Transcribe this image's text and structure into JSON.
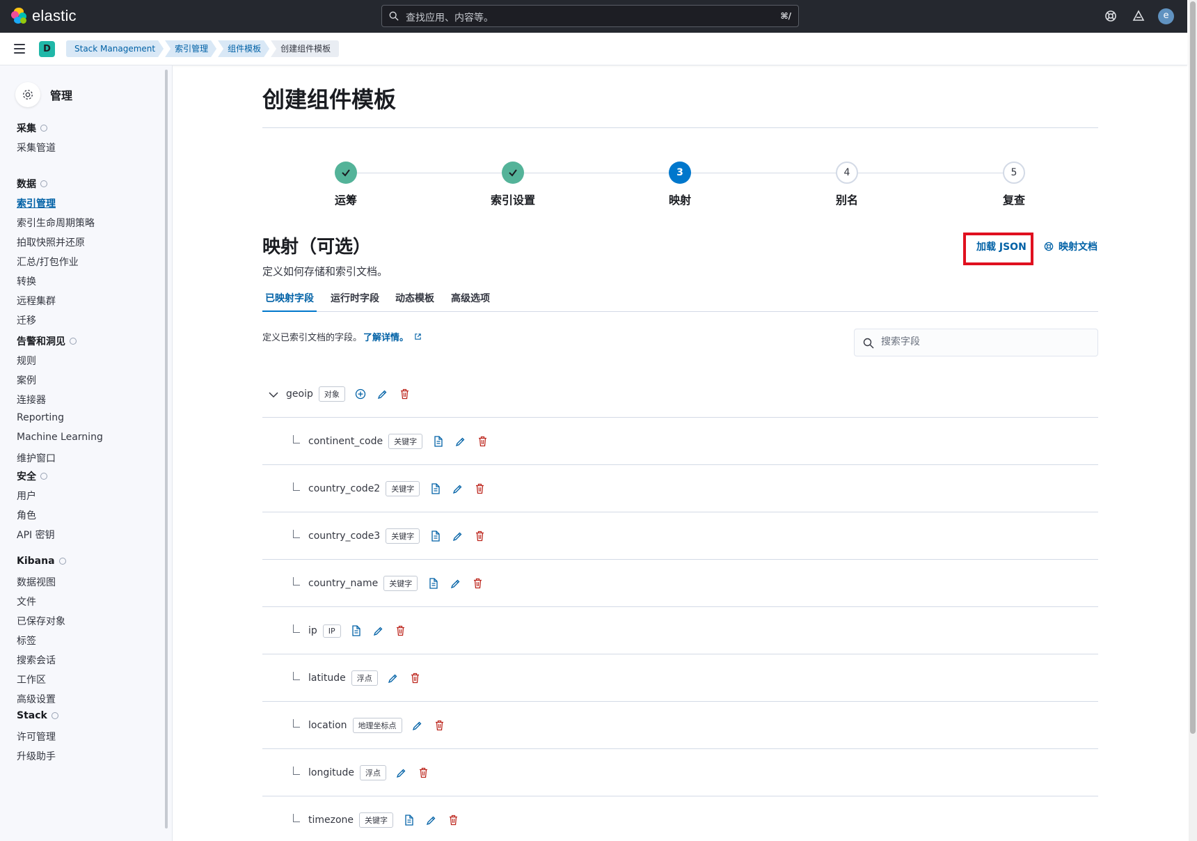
{
  "header": {
    "logo_text": "elastic",
    "search_placeholder": "查找应用、内容等。",
    "search_shortcut": "⌘/",
    "user_initial": "e"
  },
  "subheader": {
    "space_initial": "D",
    "breadcrumbs": [
      "Stack Management",
      "索引管理",
      "组件模板",
      "创建组件模板"
    ]
  },
  "sidebar": {
    "title": "管理",
    "sections": [
      {
        "heading": "采集",
        "items": [
          "采集管道"
        ]
      },
      {
        "heading": "数据",
        "items": [
          "索引管理",
          "索引生命周期策略",
          "拍取快照并还原",
          "汇总/打包作业",
          "转换",
          "远程集群",
          "迁移"
        ]
      },
      {
        "heading": "告警和洞见",
        "items": [
          "规则",
          "案例",
          "连接器",
          "Reporting",
          "Machine Learning",
          "维护窗口"
        ]
      },
      {
        "heading": "安全",
        "items": [
          "用户",
          "角色",
          "API 密钥"
        ]
      },
      {
        "heading": "Kibana",
        "items": [
          "数据视图",
          "文件",
          "已保存对象",
          "标签",
          "搜索会话",
          "工作区",
          "高级设置"
        ]
      },
      {
        "heading": "Stack",
        "items": [
          "许可管理",
          "升级助手"
        ]
      }
    ],
    "active_item": "索引管理"
  },
  "main": {
    "page_title": "创建组件模板",
    "steps": [
      {
        "label": "运筹",
        "state": "done",
        "number": ""
      },
      {
        "label": "索引设置",
        "state": "done",
        "number": ""
      },
      {
        "label": "映射",
        "state": "current",
        "number": "3"
      },
      {
        "label": "别名",
        "state": "todo",
        "number": "4"
      },
      {
        "label": "复查",
        "state": "todo",
        "number": "5"
      }
    ],
    "section_title": "映射（可选）",
    "section_desc": "定义如何存储和索引文档。",
    "load_json": "加载 JSON",
    "mapping_docs": "映射文档",
    "tabs": [
      "已映射字段",
      "运行时字段",
      "动态模板",
      "高级选项"
    ],
    "field_desc": "定义已索引文档的字段。",
    "learn_more": "了解详情。",
    "field_search_placeholder": "搜索字段",
    "fields": [
      {
        "name": "geoip",
        "type": "对象",
        "parent": true,
        "doc": false
      },
      {
        "name": "continent_code",
        "type": "关键字",
        "parent": false,
        "doc": true
      },
      {
        "name": "country_code2",
        "type": "关键字",
        "parent": false,
        "doc": true
      },
      {
        "name": "country_code3",
        "type": "关键字",
        "parent": false,
        "doc": true
      },
      {
        "name": "country_name",
        "type": "关键字",
        "parent": false,
        "doc": true
      },
      {
        "name": "ip",
        "type": "IP",
        "parent": false,
        "doc": true
      },
      {
        "name": "latitude",
        "type": "浮点",
        "parent": false,
        "doc": false
      },
      {
        "name": "location",
        "type": "地理坐标点",
        "parent": false,
        "doc": false
      },
      {
        "name": "longitude",
        "type": "浮点",
        "parent": false,
        "doc": false
      },
      {
        "name": "timezone",
        "type": "关键字",
        "parent": false,
        "doc": true
      }
    ]
  },
  "colors": {
    "link": "#0061a6",
    "done": "#54b399",
    "current": "#0077cc",
    "danger": "#bd271e",
    "highlight": "#e0101f"
  }
}
